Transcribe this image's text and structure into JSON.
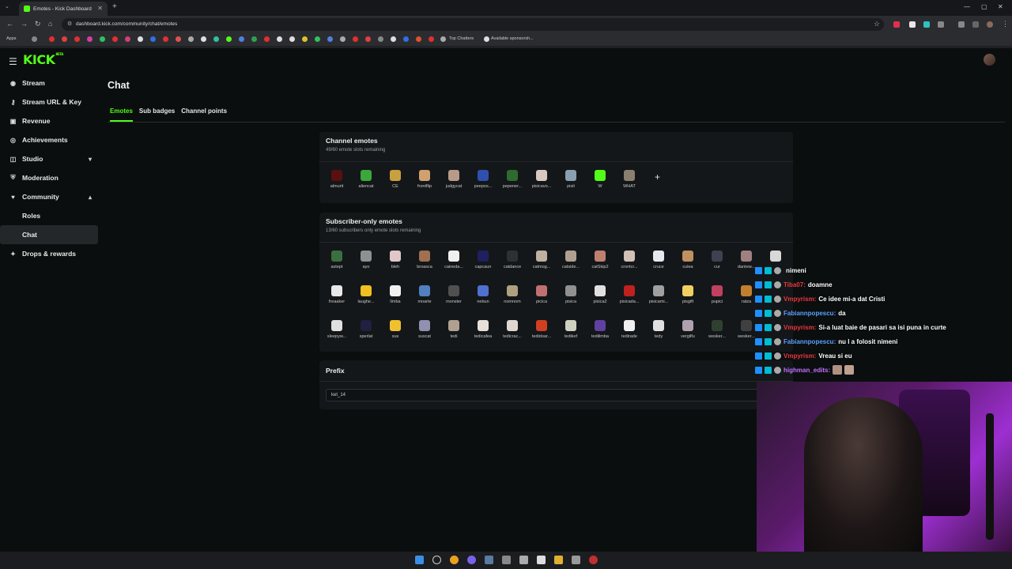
{
  "browser": {
    "tab_title": "Emotes - Kick Dashboard",
    "url": "dashboard.kick.com/community/chat/emotes",
    "bookmarks": [
      "Apps",
      "Top Chatters",
      "Available sponsorsh..."
    ]
  },
  "app": {
    "logo": "KICK",
    "logo_badge": "BETA"
  },
  "sidebar": {
    "items": [
      {
        "label": "Stream",
        "icon": "broadcast-icon"
      },
      {
        "label": "Stream URL & Key",
        "icon": "key-icon"
      },
      {
        "label": "Revenue",
        "icon": "wallet-icon"
      },
      {
        "label": "Achievements",
        "icon": "trophy-icon"
      },
      {
        "label": "Studio",
        "icon": "studio-icon",
        "expand": "▾"
      },
      {
        "label": "Moderation",
        "icon": "shield-icon"
      },
      {
        "label": "Community",
        "icon": "community-icon",
        "expand": "▴"
      }
    ],
    "sub_items": [
      {
        "label": "Roles"
      },
      {
        "label": "Chat"
      }
    ],
    "bottom_item": {
      "label": "Drops & rewards",
      "icon": "gift-icon"
    }
  },
  "page": {
    "title": "Chat",
    "tabs": [
      "Emotes",
      "Sub badges",
      "Channel points"
    ]
  },
  "channel_emotes": {
    "title": "Channel emotes",
    "subtitle": "49/60 emote slots remaining",
    "add_label": "+",
    "emotes": [
      {
        "name": "almurit",
        "color": "#5a1010"
      },
      {
        "name": "aliencat",
        "color": "#3aa83a"
      },
      {
        "name": "CE",
        "color": "#c8a040"
      },
      {
        "name": "frontflip",
        "color": "#d0a070"
      },
      {
        "name": "judgycat",
        "color": "#b89a88"
      },
      {
        "name": "peepos...",
        "color": "#3050b0"
      },
      {
        "name": "pepener...",
        "color": "#2f6a2f"
      },
      {
        "name": "pisicavo...",
        "color": "#d8c8c0"
      },
      {
        "name": "pisit",
        "color": "#8aa0b0"
      },
      {
        "name": "W",
        "color": "#53fc18"
      },
      {
        "name": "WHAT",
        "color": "#8a8070"
      }
    ]
  },
  "subscriber_emotes": {
    "title": "Subscriber-only emotes",
    "subtitle": "13/60 subscribers only emote slots remaining",
    "rows": [
      [
        {
          "name": "astept",
          "color": "#3a7040"
        },
        {
          "name": "ayo",
          "color": "#909090"
        },
        {
          "name": "bleh",
          "color": "#e0c8c8"
        },
        {
          "name": "broasca",
          "color": "#a07050"
        },
        {
          "name": "caineda...",
          "color": "#f0f0f0"
        },
        {
          "name": "capcaun",
          "color": "#202060"
        },
        {
          "name": "catdance",
          "color": "#303030"
        },
        {
          "name": "catmog...",
          "color": "#c0b0a0"
        },
        {
          "name": "catside...",
          "color": "#b0a090"
        },
        {
          "name": "catSkip2",
          "color": "#c08070"
        },
        {
          "name": "crontcr...",
          "color": "#d0c0b8"
        },
        {
          "name": "cruce",
          "color": "#e8e8f0"
        },
        {
          "name": "culea",
          "color": "#c09060"
        },
        {
          "name": "cur",
          "color": "#404050"
        },
        {
          "name": "dantew...",
          "color": "#a08080"
        },
        {
          "name": "",
          "color": "#d8d8d8"
        }
      ],
      [
        {
          "name": "freaaker",
          "color": "#e8e8e8"
        },
        {
          "name": "laughe...",
          "color": "#f0c020"
        },
        {
          "name": "limba",
          "color": "#f0f0f0"
        },
        {
          "name": "moarte",
          "color": "#5080c0"
        },
        {
          "name": "monster",
          "color": "#505050"
        },
        {
          "name": "nebun",
          "color": "#5070d0"
        },
        {
          "name": "nomnom",
          "color": "#b0a080"
        },
        {
          "name": "picica",
          "color": "#c07070"
        },
        {
          "name": "pisica",
          "color": "#909090"
        },
        {
          "name": "pisica2",
          "color": "#e0e0e0"
        },
        {
          "name": "pisicada...",
          "color": "#c02020"
        },
        {
          "name": "pisicami...",
          "color": "#a0a0a0"
        },
        {
          "name": "pisgift",
          "color": "#f0d060"
        },
        {
          "name": "pupici",
          "color": "#c04060"
        },
        {
          "name": "ratza",
          "color": "#c08030"
        }
      ],
      [
        {
          "name": "sleepyw...",
          "color": "#e0e0e0"
        },
        {
          "name": "sperlat",
          "color": "#202040"
        },
        {
          "name": "sus",
          "color": "#f0c030"
        },
        {
          "name": "suscat",
          "color": "#9090b0"
        },
        {
          "name": "tedi",
          "color": "#b0a090"
        },
        {
          "name": "tedicafea",
          "color": "#e8e0d8"
        },
        {
          "name": "tedicrac...",
          "color": "#e0d8d0"
        },
        {
          "name": "tedidoar...",
          "color": "#d04020"
        },
        {
          "name": "tedikef",
          "color": "#d0d0c0"
        },
        {
          "name": "tedilimba",
          "color": "#6040a0"
        },
        {
          "name": "tedirade",
          "color": "#f0f0f0"
        },
        {
          "name": "tedy",
          "color": "#e0e0e0"
        },
        {
          "name": "vergilfu",
          "color": "#b0a0b0"
        },
        {
          "name": "wesker...",
          "color": "#304030"
        },
        {
          "name": "wesker...",
          "color": "#404040"
        }
      ]
    ]
  },
  "prefix": {
    "title": "Prefix",
    "value": "ket_14"
  },
  "chat_overlay": [
    {
      "user": "",
      "color": "#ffffff",
      "message": "nimeni"
    },
    {
      "user": "Tiba07:",
      "color": "#e8383d",
      "message": "doamne"
    },
    {
      "user": "Vmpyrism:",
      "color": "#e8383d",
      "message": "Ce idee mi-a dat Cristi"
    },
    {
      "user": "Fabiannpopescu:",
      "color": "#5aa0ff",
      "message": "da"
    },
    {
      "user": "Vmpyrism:",
      "color": "#e8383d",
      "message": "Si-a luat baie de pasari sa isi puna in curte"
    },
    {
      "user": "Fabiannpopescu:",
      "color": "#5aa0ff",
      "message": "nu l a folosit nimeni"
    },
    {
      "user": "Vmpyrism:",
      "color": "#e8383d",
      "message": "Vreau si eu"
    },
    {
      "user": "highman_edits:",
      "color": "#c070ff",
      "message": ""
    }
  ],
  "colors": {
    "accent": "#53fc18",
    "background": "#0b0e0f",
    "card": "#141719"
  }
}
